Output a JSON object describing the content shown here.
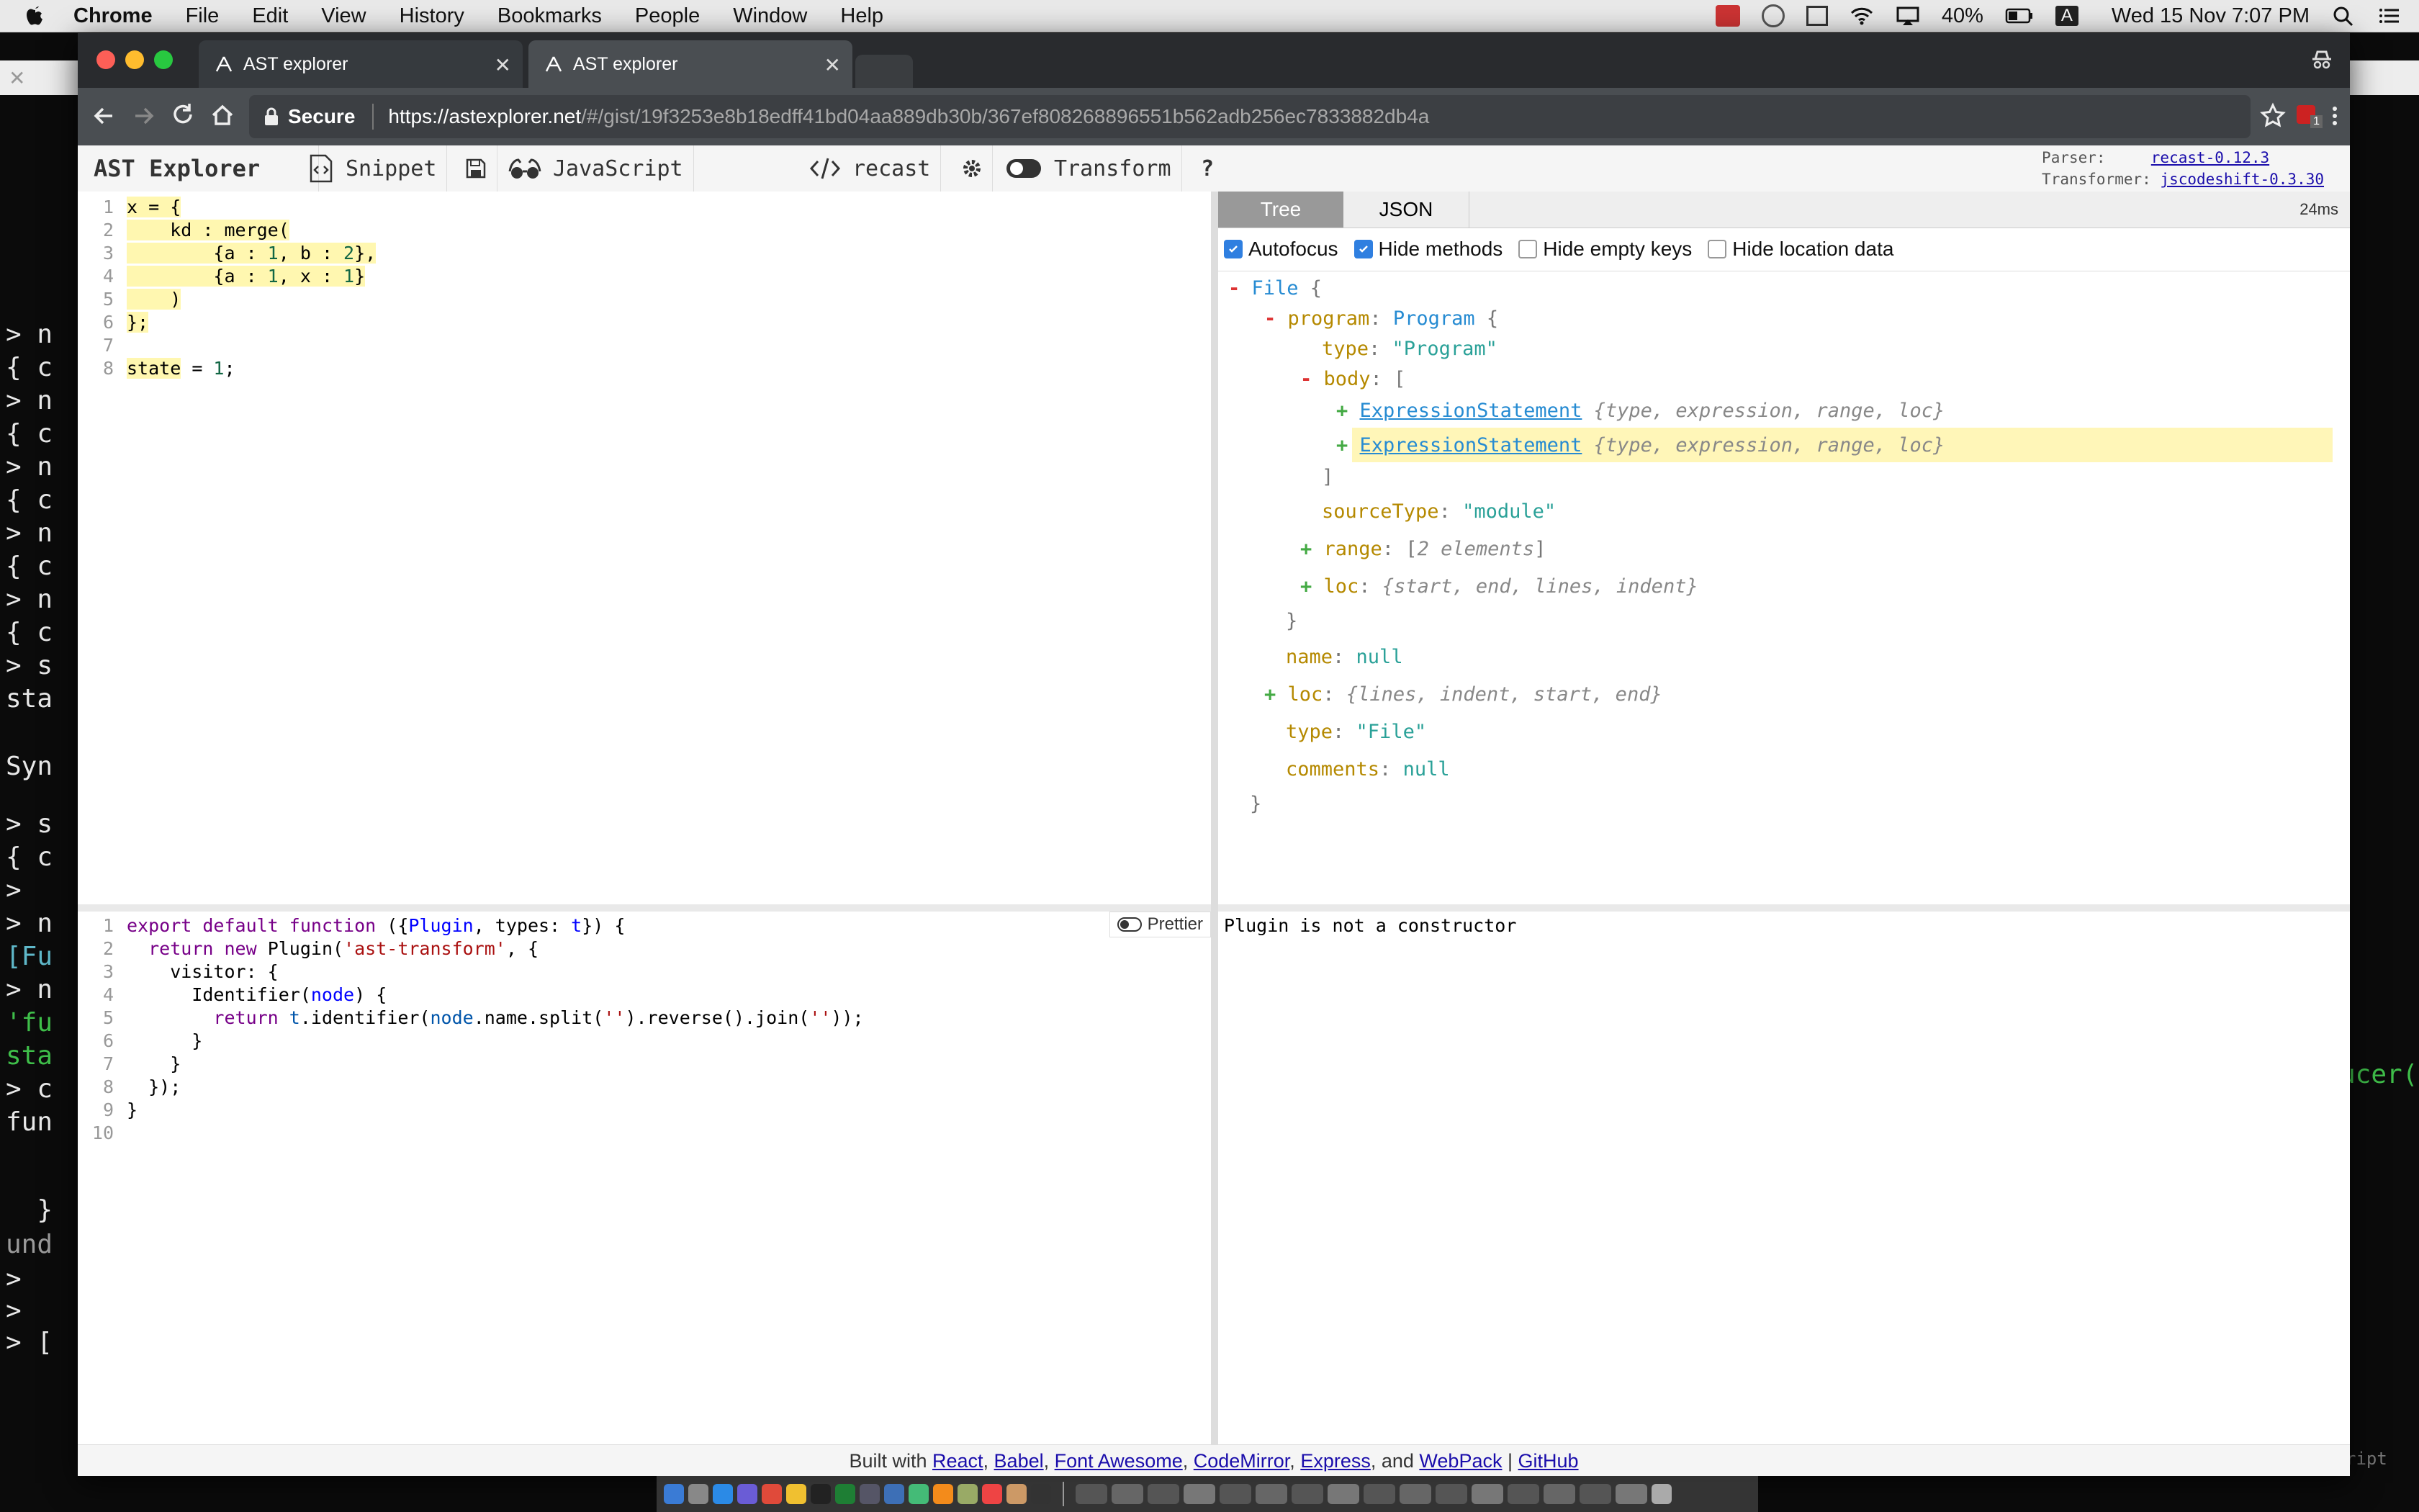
{
  "menubar": {
    "app": "Chrome",
    "items": [
      "File",
      "Edit",
      "View",
      "History",
      "Bookmarks",
      "People",
      "Window",
      "Help"
    ],
    "battery": "40%",
    "clock": "Wed 15 Nov  7:07 PM",
    "input_source": "A"
  },
  "terminal": {
    "lines": [
      {
        "text": "> n",
        "cls": ""
      },
      {
        "text": "{ c",
        "cls": ""
      },
      {
        "text": "> n",
        "cls": ""
      },
      {
        "text": "{ c",
        "cls": ""
      },
      {
        "text": "> n",
        "cls": ""
      },
      {
        "text": "{ c",
        "cls": ""
      },
      {
        "text": "> n",
        "cls": ""
      },
      {
        "text": "{ c",
        "cls": ""
      },
      {
        "text": "> n",
        "cls": ""
      },
      {
        "text": "{ c",
        "cls": ""
      },
      {
        "text": "> s",
        "cls": ""
      },
      {
        "text": "sta",
        "cls": ""
      },
      {
        "text": "Syn",
        "cls": ""
      },
      {
        "text": "> s",
        "cls": ""
      },
      {
        "text": "{ c",
        "cls": ""
      },
      {
        "text": ">",
        "cls": ""
      },
      {
        "text": "> n",
        "cls": ""
      },
      {
        "text": "[Fu",
        "cls": "cyan"
      },
      {
        "text": "> n",
        "cls": ""
      },
      {
        "text": "'fu",
        "cls": "green"
      },
      {
        "text": "sta",
        "cls": "green"
      },
      {
        "text": "> c",
        "cls": ""
      },
      {
        "text": "fun",
        "cls": ""
      },
      {
        "text": "  }",
        "cls": ""
      },
      {
        "text": "und",
        "cls": "dim"
      },
      {
        "text": ">",
        "cls": ""
      },
      {
        "text": ">",
        "cls": ""
      },
      {
        "text": "> [",
        "cls": ""
      }
    ],
    "right_fragment": "ucer(",
    "right_fragment2": "ript"
  },
  "browser": {
    "tabs": [
      {
        "title": "AST explorer",
        "active": false
      },
      {
        "title": "AST explorer",
        "active": true
      }
    ],
    "secure_label": "Secure",
    "url_host": "https://astexplorer.net",
    "url_path": "/#/gist/19f3253e8b18edff41bd04aa889db30b/367ef808268896551b562adb256ec7833882db4a",
    "extension_badge": "1"
  },
  "app": {
    "title": "AST Explorer",
    "snippet": "Snippet",
    "language": "JavaScript",
    "parser": "recast",
    "transform": "Transform",
    "help": "?",
    "meta": {
      "parser_label": "Parser:",
      "parser_value": "recast-0.12.3",
      "transformer_label": "Transformer:",
      "transformer_value": "jscodeshift-0.3.30"
    }
  },
  "tree_panel": {
    "tabs": [
      "Tree",
      "JSON"
    ],
    "timing": "24ms",
    "options": [
      {
        "label": "Autofocus",
        "checked": true
      },
      {
        "label": "Hide methods",
        "checked": true
      },
      {
        "label": "Hide empty keys",
        "checked": false
      },
      {
        "label": "Hide location data",
        "checked": false
      }
    ],
    "nodes": {
      "file": "File",
      "program_key": "program",
      "program_type": "Program",
      "type_key": "type",
      "type_program": "\"Program\"",
      "body_key": "body",
      "expr1": "ExpressionStatement",
      "expr1_summary": "{type, expression, range, loc}",
      "expr2": "ExpressionStatement",
      "expr2_summary": "{type, expression, range, loc}",
      "sourceType_key": "sourceType",
      "sourceType_val": "\"module\"",
      "range_key": "range",
      "range_summary": "2 elements",
      "loc_key": "loc",
      "loc_summary": "{start, end, lines, indent}",
      "name_key": "name",
      "name_val": "null",
      "loc2_key": "loc",
      "loc2_summary": "{lines, indent, start, end}",
      "type2_key": "type",
      "type2_val": "\"File\"",
      "comments_key": "comments",
      "comments_val": "null"
    }
  },
  "transform_editor": {
    "prettier": "Prettier"
  },
  "output": {
    "error": "Plugin is not a constructor"
  },
  "footer": {
    "prefix": "Built with ",
    "links": [
      "React",
      "Babel",
      "Font Awesome",
      "CodeMirror",
      "Express",
      "WebPack"
    ],
    "and": ", and ",
    "github": "GitHub"
  }
}
